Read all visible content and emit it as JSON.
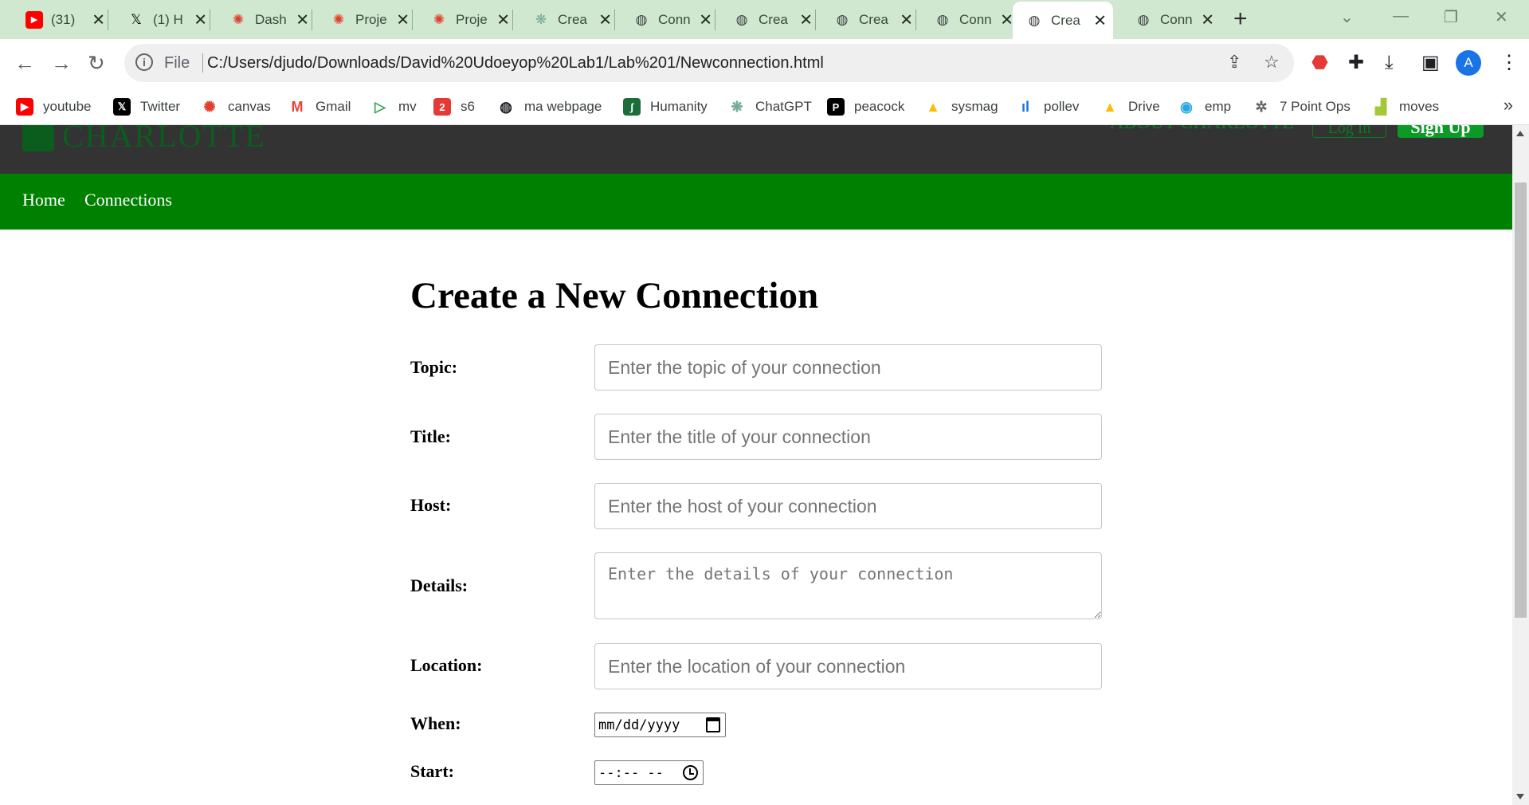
{
  "browser": {
    "tabs": [
      {
        "title": "(31)",
        "icon": "youtube-icon",
        "color": "#ff0000"
      },
      {
        "title": "(1) H",
        "icon": "x-twitter-icon",
        "color": "#000000"
      },
      {
        "title": "Dash",
        "icon": "canvas-icon",
        "color": "#e03e2d"
      },
      {
        "title": "Proje",
        "icon": "canvas-icon",
        "color": "#e03e2d"
      },
      {
        "title": "Proje",
        "icon": "canvas-icon",
        "color": "#e03e2d"
      },
      {
        "title": "Crea",
        "icon": "openai-icon",
        "color": "#74aa9c"
      },
      {
        "title": "Conn",
        "icon": "globe-icon",
        "color": "#3c4043"
      },
      {
        "title": "Crea",
        "icon": "globe-icon",
        "color": "#3c4043"
      },
      {
        "title": "Crea",
        "icon": "globe-icon",
        "color": "#3c4043"
      },
      {
        "title": "Conn",
        "icon": "globe-icon",
        "color": "#3c4043"
      },
      {
        "title": "Crea",
        "icon": "globe-icon",
        "color": "#3c4043",
        "active": true
      },
      {
        "title": "Conn",
        "icon": "globe-icon",
        "color": "#3c4043"
      }
    ],
    "address": {
      "scheme_label": "File",
      "url": "C:/Users/djudo/Downloads/David%20Udoeyop%20Lab1/Lab%201/Newconnection.html"
    },
    "profile_initial": "A",
    "bookmarks": [
      {
        "label": "youtube",
        "icon": "youtube-icon",
        "color": "#ff0000"
      },
      {
        "label": "Twitter",
        "icon": "x-twitter-icon",
        "color": "#000000"
      },
      {
        "label": "canvas",
        "icon": "canvas-icon",
        "color": "#e03e2d"
      },
      {
        "label": "Gmail",
        "icon": "gmail-icon",
        "color": "#ea4335"
      },
      {
        "label": "mv",
        "icon": "play-icon",
        "color": "#34a853"
      },
      {
        "label": "s6",
        "icon": "s6-icon",
        "color": "#e53935"
      },
      {
        "label": "ma webpage",
        "icon": "globe-icon",
        "color": "#202124"
      },
      {
        "label": "Humanity",
        "icon": "humanity-icon",
        "color": "#1b6e3a"
      },
      {
        "label": "ChatGPT",
        "icon": "openai-icon",
        "color": "#74aa9c"
      },
      {
        "label": "peacock",
        "icon": "peacock-icon",
        "color": "#000000"
      },
      {
        "label": "sysmag",
        "icon": "drive-icon",
        "color": "#fbbc04"
      },
      {
        "label": "pollev",
        "icon": "pollev-icon",
        "color": "#1a73e8"
      },
      {
        "label": "Drive",
        "icon": "drive-icon",
        "color": "#fbbc04"
      },
      {
        "label": "emp",
        "icon": "emp-icon",
        "color": "#29a8e0"
      },
      {
        "label": "7 Point Ops",
        "icon": "sparkle-icon",
        "color": "#5f6368"
      },
      {
        "label": "moves",
        "icon": "android-icon",
        "color": "#a4c639"
      }
    ],
    "bookmarks_more": "»"
  },
  "site": {
    "logo_text": "CHARLOTTE",
    "header_link": "ABOUT CHARLOTTE",
    "login_label": "Log In",
    "signup_label": "Sign Up",
    "nav": [
      "Home",
      "Connections"
    ]
  },
  "form": {
    "title": "Create a New Connection",
    "fields": {
      "topic": {
        "label": "Topic:",
        "placeholder": "Enter the topic of your connection"
      },
      "title": {
        "label": "Title:",
        "placeholder": "Enter the title of your connection"
      },
      "host": {
        "label": "Host:",
        "placeholder": "Enter the host of your connection"
      },
      "details": {
        "label": "Details:",
        "placeholder": "Enter the details of your connection"
      },
      "location": {
        "label": "Location:",
        "placeholder": "Enter the location of your connection"
      },
      "when": {
        "label": "When:",
        "value": "mm/dd/yyyy"
      },
      "start": {
        "label": "Start:",
        "value": "--:-- --"
      }
    }
  },
  "colors": {
    "tabstrip": "#cfe8cf",
    "site_header": "#333333",
    "site_nav": "#008000"
  }
}
